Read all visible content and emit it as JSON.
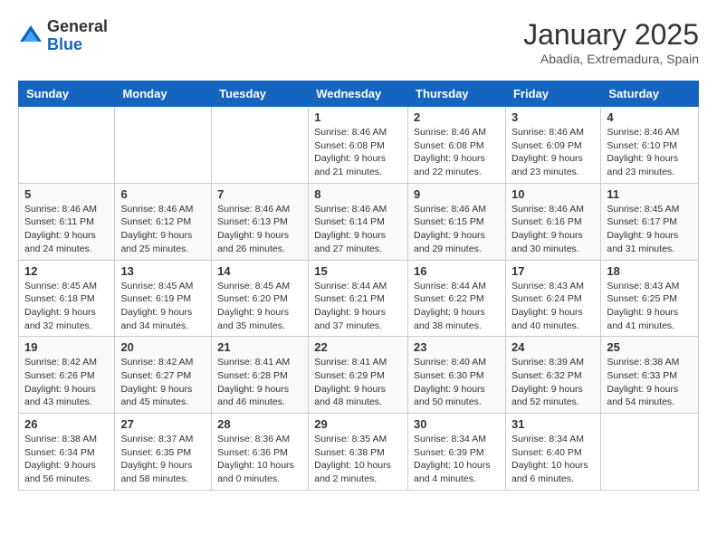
{
  "header": {
    "logo_general": "General",
    "logo_blue": "Blue",
    "title": "January 2025",
    "subtitle": "Abadia, Extremadura, Spain"
  },
  "weekdays": [
    "Sunday",
    "Monday",
    "Tuesday",
    "Wednesday",
    "Thursday",
    "Friday",
    "Saturday"
  ],
  "weeks": [
    [
      {
        "day": "",
        "info": ""
      },
      {
        "day": "",
        "info": ""
      },
      {
        "day": "",
        "info": ""
      },
      {
        "day": "1",
        "info": "Sunrise: 8:46 AM\nSunset: 6:08 PM\nDaylight: 9 hours\nand 21 minutes."
      },
      {
        "day": "2",
        "info": "Sunrise: 8:46 AM\nSunset: 6:08 PM\nDaylight: 9 hours\nand 22 minutes."
      },
      {
        "day": "3",
        "info": "Sunrise: 8:46 AM\nSunset: 6:09 PM\nDaylight: 9 hours\nand 23 minutes."
      },
      {
        "day": "4",
        "info": "Sunrise: 8:46 AM\nSunset: 6:10 PM\nDaylight: 9 hours\nand 23 minutes."
      }
    ],
    [
      {
        "day": "5",
        "info": "Sunrise: 8:46 AM\nSunset: 6:11 PM\nDaylight: 9 hours\nand 24 minutes."
      },
      {
        "day": "6",
        "info": "Sunrise: 8:46 AM\nSunset: 6:12 PM\nDaylight: 9 hours\nand 25 minutes."
      },
      {
        "day": "7",
        "info": "Sunrise: 8:46 AM\nSunset: 6:13 PM\nDaylight: 9 hours\nand 26 minutes."
      },
      {
        "day": "8",
        "info": "Sunrise: 8:46 AM\nSunset: 6:14 PM\nDaylight: 9 hours\nand 27 minutes."
      },
      {
        "day": "9",
        "info": "Sunrise: 8:46 AM\nSunset: 6:15 PM\nDaylight: 9 hours\nand 29 minutes."
      },
      {
        "day": "10",
        "info": "Sunrise: 8:46 AM\nSunset: 6:16 PM\nDaylight: 9 hours\nand 30 minutes."
      },
      {
        "day": "11",
        "info": "Sunrise: 8:45 AM\nSunset: 6:17 PM\nDaylight: 9 hours\nand 31 minutes."
      }
    ],
    [
      {
        "day": "12",
        "info": "Sunrise: 8:45 AM\nSunset: 6:18 PM\nDaylight: 9 hours\nand 32 minutes."
      },
      {
        "day": "13",
        "info": "Sunrise: 8:45 AM\nSunset: 6:19 PM\nDaylight: 9 hours\nand 34 minutes."
      },
      {
        "day": "14",
        "info": "Sunrise: 8:45 AM\nSunset: 6:20 PM\nDaylight: 9 hours\nand 35 minutes."
      },
      {
        "day": "15",
        "info": "Sunrise: 8:44 AM\nSunset: 6:21 PM\nDaylight: 9 hours\nand 37 minutes."
      },
      {
        "day": "16",
        "info": "Sunrise: 8:44 AM\nSunset: 6:22 PM\nDaylight: 9 hours\nand 38 minutes."
      },
      {
        "day": "17",
        "info": "Sunrise: 8:43 AM\nSunset: 6:24 PM\nDaylight: 9 hours\nand 40 minutes."
      },
      {
        "day": "18",
        "info": "Sunrise: 8:43 AM\nSunset: 6:25 PM\nDaylight: 9 hours\nand 41 minutes."
      }
    ],
    [
      {
        "day": "19",
        "info": "Sunrise: 8:42 AM\nSunset: 6:26 PM\nDaylight: 9 hours\nand 43 minutes."
      },
      {
        "day": "20",
        "info": "Sunrise: 8:42 AM\nSunset: 6:27 PM\nDaylight: 9 hours\nand 45 minutes."
      },
      {
        "day": "21",
        "info": "Sunrise: 8:41 AM\nSunset: 6:28 PM\nDaylight: 9 hours\nand 46 minutes."
      },
      {
        "day": "22",
        "info": "Sunrise: 8:41 AM\nSunset: 6:29 PM\nDaylight: 9 hours\nand 48 minutes."
      },
      {
        "day": "23",
        "info": "Sunrise: 8:40 AM\nSunset: 6:30 PM\nDaylight: 9 hours\nand 50 minutes."
      },
      {
        "day": "24",
        "info": "Sunrise: 8:39 AM\nSunset: 6:32 PM\nDaylight: 9 hours\nand 52 minutes."
      },
      {
        "day": "25",
        "info": "Sunrise: 8:38 AM\nSunset: 6:33 PM\nDaylight: 9 hours\nand 54 minutes."
      }
    ],
    [
      {
        "day": "26",
        "info": "Sunrise: 8:38 AM\nSunset: 6:34 PM\nDaylight: 9 hours\nand 56 minutes."
      },
      {
        "day": "27",
        "info": "Sunrise: 8:37 AM\nSunset: 6:35 PM\nDaylight: 9 hours\nand 58 minutes."
      },
      {
        "day": "28",
        "info": "Sunrise: 8:36 AM\nSunset: 6:36 PM\nDaylight: 10 hours\nand 0 minutes."
      },
      {
        "day": "29",
        "info": "Sunrise: 8:35 AM\nSunset: 6:38 PM\nDaylight: 10 hours\nand 2 minutes."
      },
      {
        "day": "30",
        "info": "Sunrise: 8:34 AM\nSunset: 6:39 PM\nDaylight: 10 hours\nand 4 minutes."
      },
      {
        "day": "31",
        "info": "Sunrise: 8:34 AM\nSunset: 6:40 PM\nDaylight: 10 hours\nand 6 minutes."
      },
      {
        "day": "",
        "info": ""
      }
    ]
  ]
}
